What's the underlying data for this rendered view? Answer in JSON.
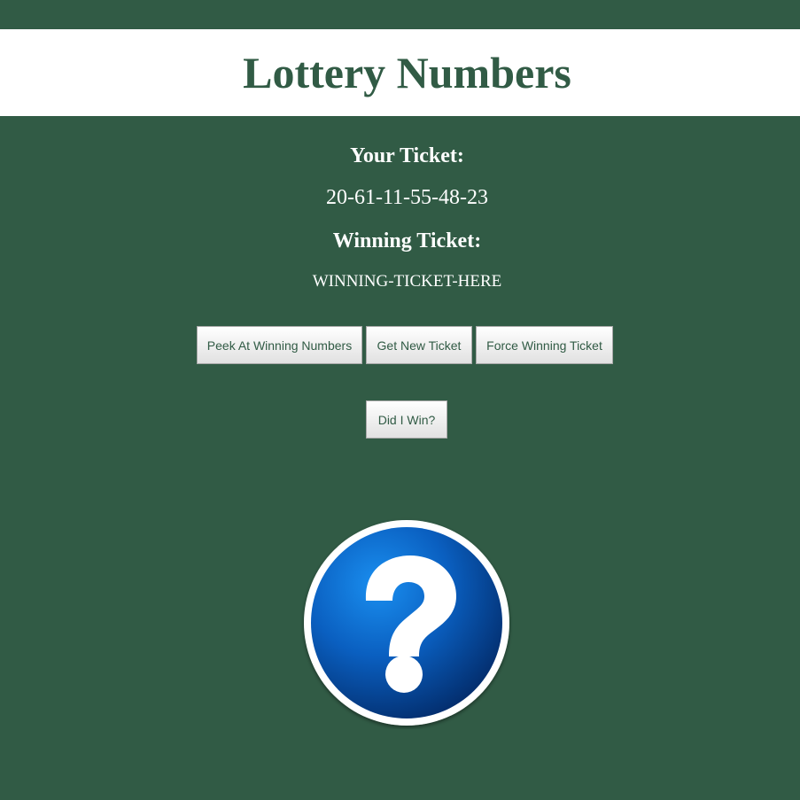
{
  "header": {
    "title": "Lottery Numbers"
  },
  "ticket": {
    "your_label": "Your Ticket:",
    "your_value": "20-61-11-55-48-23",
    "winning_label": "Winning Ticket:",
    "winning_value": "WINNING-TICKET-HERE"
  },
  "buttons": {
    "peek": "Peek At Winning Numbers",
    "new_ticket": "Get New Ticket",
    "force": "Force Winning Ticket",
    "did_i_win": "Did I Win?"
  },
  "result_image": {
    "icon": "question-mark-icon"
  },
  "colors": {
    "background": "#315b45",
    "header_bg": "#ffffff",
    "title": "#315b45",
    "icon_blue": "#0a63c5"
  }
}
